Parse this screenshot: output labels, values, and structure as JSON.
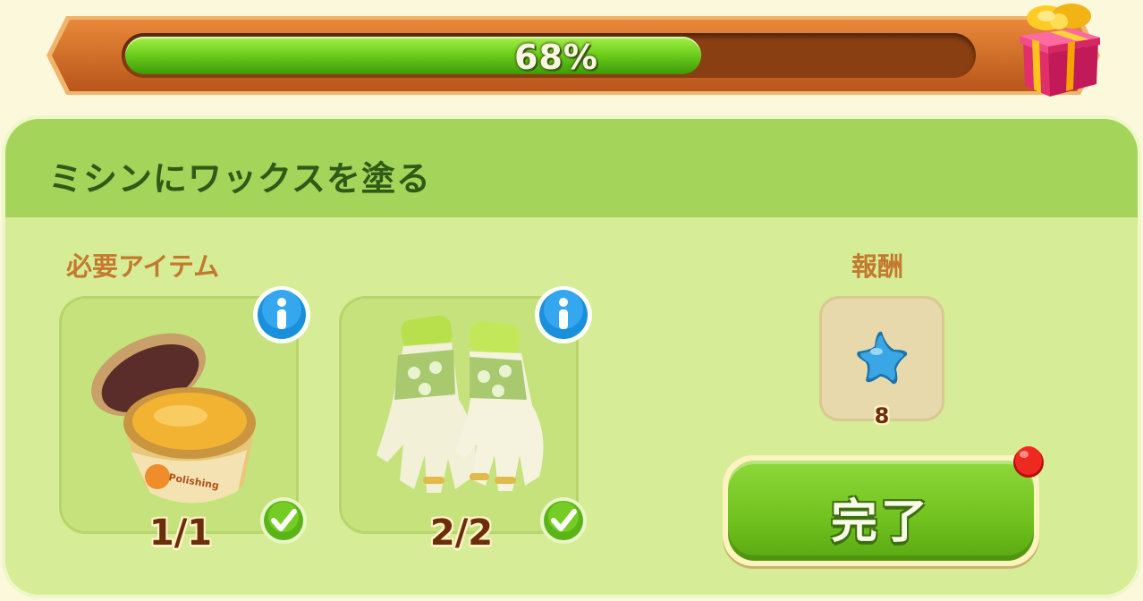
{
  "progress": {
    "percent": 68,
    "label": "68%",
    "reward_icon": "gift-box-icon"
  },
  "task": {
    "title": "ミシンにワックスを塗る",
    "required_label": "必要アイテム",
    "reward_label": "報酬",
    "items": [
      {
        "name": "polishing wax jar",
        "icon": "wax-jar-icon",
        "count": "1/1",
        "completed": true,
        "info_icon": "info-icon"
      },
      {
        "name": "gardening gloves",
        "icon": "gloves-icon",
        "count": "2/2",
        "completed": true,
        "info_icon": "info-icon"
      }
    ],
    "reward": {
      "icon": "blue-star-icon",
      "amount": "8"
    },
    "complete_button": {
      "label": "完了",
      "has_notification": true
    }
  },
  "colors": {
    "panel_bg": "#d6ec96",
    "header_bg": "#a5d45a",
    "title_text": "#2f5a17",
    "section_text": "#c37a2e",
    "progress_fill": "#6ed01c",
    "progress_frame": "#d4742c",
    "notification": "#e02020"
  }
}
